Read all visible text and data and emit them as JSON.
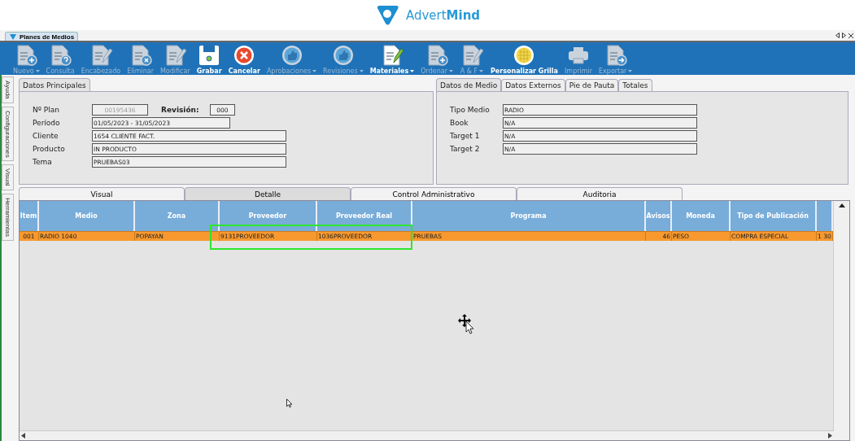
{
  "logo": {
    "text": "Advert**Mind**"
  },
  "doc_tab": {
    "label": "Planes de Medios",
    "selected": true
  },
  "toolbar": [
    {
      "label": "Nuevo",
      "kind": "doc-plus",
      "enabled": false,
      "dropdown": true
    },
    {
      "label": "Consulta",
      "kind": "doc-question",
      "enabled": false,
      "dropdown": false
    },
    {
      "label": "Encabezado",
      "kind": "doc-pencil",
      "enabled": false,
      "dropdown": false
    },
    {
      "label": "Eliminar",
      "kind": "doc-x",
      "enabled": false,
      "dropdown": false
    },
    {
      "label": "Modificar",
      "kind": "doc-pencil",
      "enabled": false,
      "dropdown": false
    },
    {
      "label": "Grabar",
      "kind": "save",
      "enabled": true,
      "dropdown": false
    },
    {
      "label": "Cancelar",
      "kind": "cancel",
      "enabled": true,
      "dropdown": false
    },
    {
      "label": "Aprobaciones",
      "kind": "thumb",
      "enabled": false,
      "dropdown": true
    },
    {
      "label": "Revisiones",
      "kind": "thumb",
      "enabled": false,
      "dropdown": true
    },
    {
      "label": "Materiales",
      "kind": "doc-pencil-green",
      "enabled": true,
      "dropdown": true
    },
    {
      "label": "Ordenar",
      "kind": "doc-plus",
      "enabled": false,
      "dropdown": true
    },
    {
      "label": "A & F",
      "kind": "doc-pencil",
      "enabled": false,
      "dropdown": true
    },
    {
      "label": "Personalizar Grilla",
      "kind": "grid",
      "enabled": true,
      "dropdown": false
    },
    {
      "label": "Imprimir",
      "kind": "printer",
      "enabled": false,
      "dropdown": false
    },
    {
      "label": "Exportar",
      "kind": "doc-arrow",
      "enabled": false,
      "dropdown": true
    }
  ],
  "side_tabs": [
    {
      "label": "Ayuda"
    },
    {
      "label": "Configuraciones"
    },
    {
      "label": "Visual"
    },
    {
      "label": "Herramientas"
    }
  ],
  "main_panel": {
    "tabs": [
      {
        "label": "Datos Principales",
        "selected": true
      }
    ],
    "plan": {
      "label": "Nº Plan",
      "value": "00195436",
      "disabled": true
    },
    "revision": {
      "label": "Revisión:",
      "value": "000"
    },
    "fields": [
      {
        "label": "Período",
        "value": "01/05/2023 - 31/05/2023"
      },
      {
        "label": "Cliente",
        "value": "1654 CLIENTE FACT."
      },
      {
        "label": "Producto",
        "value": "IN PRODUCTO"
      },
      {
        "label": "Tema",
        "value": "PRUEBAS03"
      }
    ]
  },
  "media_panel": {
    "tabs": [
      {
        "label": "Datos de Medio",
        "selected": true
      },
      {
        "label": "Datos Externos",
        "selected": false
      },
      {
        "label": "Pie de Pauta",
        "selected": false
      },
      {
        "label": "Totales",
        "selected": false
      }
    ],
    "fields": [
      {
        "label": "Tipo Medio",
        "value": "RADIO"
      },
      {
        "label": "Book",
        "value": "N/A"
      },
      {
        "label": "Target 1",
        "value": "N/A"
      },
      {
        "label": "Target 2",
        "value": "N/A"
      }
    ]
  },
  "detail_tabs": [
    {
      "label": "Visual",
      "selected": false
    },
    {
      "label": "Detalle",
      "selected": true
    },
    {
      "label": "Control Administrativo",
      "selected": false
    },
    {
      "label": "Auditoria",
      "selected": false
    }
  ],
  "table": {
    "columns": [
      {
        "label": "Item"
      },
      {
        "label": "Medio"
      },
      {
        "label": "Zona"
      },
      {
        "label": "Proveedor"
      },
      {
        "label": "Proveedor Real"
      },
      {
        "label": "Programa"
      },
      {
        "label": "Avisos"
      },
      {
        "label": "Moneda"
      },
      {
        "label": "Tipo de Publicación"
      },
      {}
    ],
    "rows": [
      {
        "selected": true,
        "cells": [
          "001",
          "RADIO 1040",
          "POPAYAN",
          "9131PROVEEDOR",
          "1036PROVEEDOR",
          "PRUEBAS",
          "46",
          "PESO",
          "COMPRA ESPECIAL",
          "1 30"
        ]
      }
    ]
  },
  "highlight": {
    "shown": true
  }
}
